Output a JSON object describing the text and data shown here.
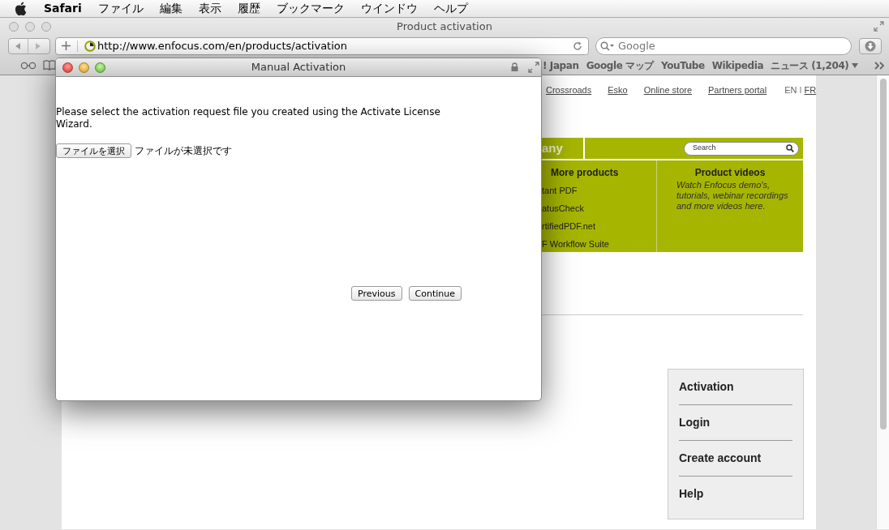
{
  "menu_bar": {
    "app_name": "Safari",
    "menus": [
      "ファイル",
      "編集",
      "表示",
      "履歴",
      "ブックマーク",
      "ウインドウ",
      "ヘルプ"
    ]
  },
  "browser": {
    "title": "Product activation",
    "url": "http://www.enfocus.com/en/products/activation",
    "search_placeholder": "Google",
    "bookmarks": [
      {
        "label": "! Japan",
        "menu": false
      },
      {
        "label": "Google マップ",
        "menu": false
      },
      {
        "label": "YouTube",
        "menu": false
      },
      {
        "label": "Wikipedia",
        "menu": false
      },
      {
        "label": "ニュース (1,204)",
        "menu": true
      }
    ]
  },
  "page": {
    "top_links": [
      "Crossroads",
      "Esko",
      "Online store",
      "Partners portal"
    ],
    "languages": [
      {
        "label": "EN",
        "selected": true
      },
      {
        "label": "FR",
        "selected": false
      }
    ],
    "language_separator": "I",
    "nav_bar": {
      "label": "any",
      "search_placeholder": "Search"
    },
    "more_products": {
      "title": "More products",
      "items": [
        "tant PDF",
        "atusCheck",
        "rtifiedPDF.net",
        "F Workflow Suite"
      ]
    },
    "product_videos": {
      "title": "Product videos",
      "text": "Watch Enfocus demo's, tutorials, webinar recordings and more videos here."
    },
    "side_menu": [
      "Activation",
      "Login",
      "Create account",
      "Help"
    ]
  },
  "dialog": {
    "title": "Manual Activation",
    "instruction": "Please select the activation request file you created using the Activate License Wizard.",
    "file_button": "ファイルを選択",
    "file_status": "ファイルが未選択です",
    "buttons": [
      "Previous",
      "Continue"
    ]
  }
}
